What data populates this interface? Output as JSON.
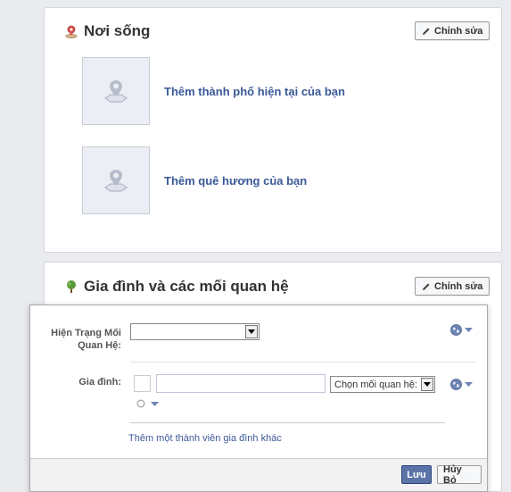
{
  "living": {
    "title": "Nơi sống",
    "edit_label": "Chỉnh sửa",
    "current_city_link": "Thêm thành phố hiện tại của bạn",
    "hometown_link": "Thêm quê hương của bạn"
  },
  "family": {
    "title": "Gia đình và các mối quan hệ",
    "edit_label": "Chỉnh sửa",
    "relationship_label": "Hiện Trạng Mối Quan Hệ:",
    "relationship_value": "",
    "family_label": "Gia đình:",
    "family_name_value": "",
    "choose_relation_label": "Chọn mối quan hệ:",
    "add_member_link": "Thêm một thành viên gia đình khác",
    "save_label": "Lưu",
    "cancel_label": "Hủy Bỏ"
  },
  "colors": {
    "link": "#3b5998",
    "save_button": "#5b74a8",
    "background": "#e9ebee"
  },
  "icons": {
    "living_title_icon": "map-pin-icon",
    "family_title_icon": "tree-icon",
    "edit_icon": "pencil-icon",
    "place_icon": "map-marker-icon",
    "privacy_icon": "globe-icon"
  }
}
